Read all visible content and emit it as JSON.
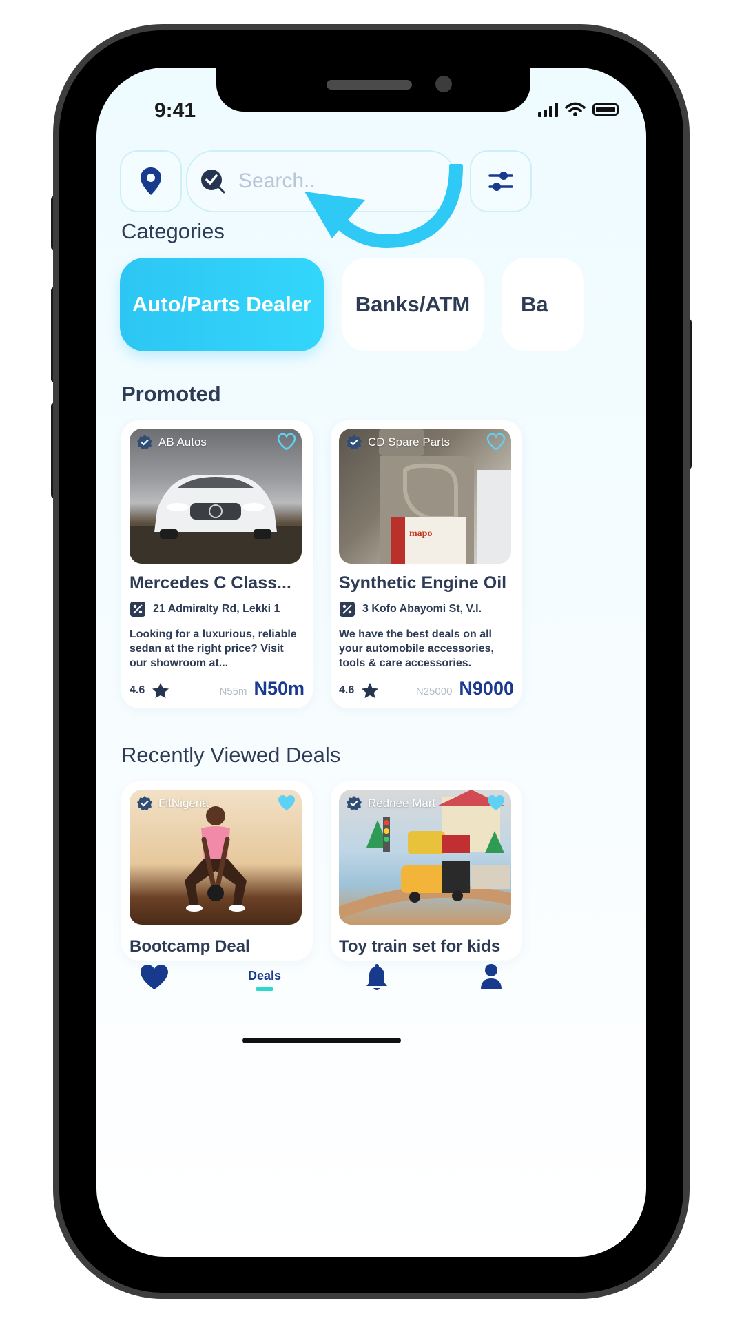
{
  "status": {
    "time": "9:41"
  },
  "search": {
    "placeholder": "Search.."
  },
  "sections": {
    "categories": "Categories",
    "promoted": "Promoted",
    "recent": "Recently Viewed Deals"
  },
  "categories": [
    {
      "label": "Auto/Parts Dealer",
      "active": true
    },
    {
      "label": "Banks/ATM",
      "active": false
    },
    {
      "label": "Ba",
      "active": false
    }
  ],
  "promoted": [
    {
      "shop": "AB Autos",
      "title": "Mercedes C Class...",
      "address": "21 Admiralty Rd, Lekki 1",
      "description": "Looking for a luxurious, reliable sedan at the right price? Visit our showroom at...",
      "rating": "4.6",
      "old_price": "N55m",
      "price": "N50m"
    },
    {
      "shop": "CD Spare Parts",
      "title": "Synthetic Engine Oil",
      "address": "3 Kofo Abayomi St, V.I.",
      "description": "We have the best deals on all your automobile accessories, tools & care accessories.",
      "rating": "4.6",
      "old_price": "N25000",
      "price": "N9000"
    }
  ],
  "recent": [
    {
      "shop": "FitNigeria",
      "title": "Bootcamp Deal"
    },
    {
      "shop": "Rednee Mart",
      "title": "Toy train set for kids"
    }
  ],
  "tabs": {
    "deals": "Deals"
  },
  "colors": {
    "accent": "#2dc6f4",
    "navy": "#1a3a8f",
    "text": "#2e3b55",
    "tab_indicator": "#2dd9c8"
  },
  "icons": [
    "location-pin-icon",
    "search-logo-icon",
    "filter-sliders-icon",
    "arrow-annotation",
    "verified-badge-icon",
    "heart-icon",
    "tag-icon",
    "star-icon",
    "bell-icon",
    "user-icon"
  ]
}
